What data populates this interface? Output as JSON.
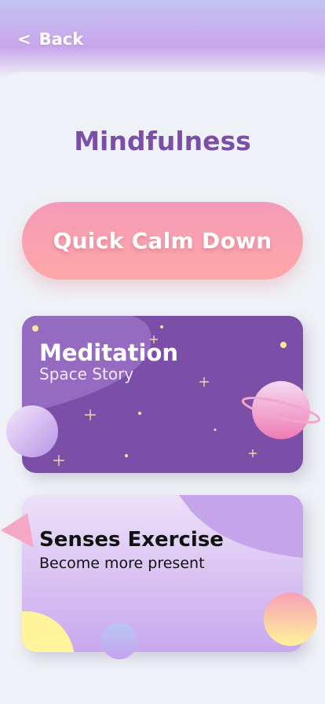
{
  "header": {
    "back_icon": "<",
    "back_label": "Back"
  },
  "page": {
    "title": "Mindfulness"
  },
  "quick_calm": {
    "label": "Quick Calm Down"
  },
  "cards": [
    {
      "title": "Meditation",
      "subtitle": "Space Story"
    },
    {
      "title": "Senses Exercise",
      "subtitle": "Become more present"
    }
  ],
  "colors": {
    "title_purple": "#7b4fa8",
    "calm_pink": "#f59ab8",
    "calm_peach": "#ffa8a8",
    "meditation_bg": "#7b4fa8",
    "senses_bg": "#d9c0f2"
  },
  "icons": [
    "chevron-left-icon",
    "planet-icon",
    "moon-icon",
    "star-icon",
    "triangle-icon",
    "circle-icon"
  ]
}
